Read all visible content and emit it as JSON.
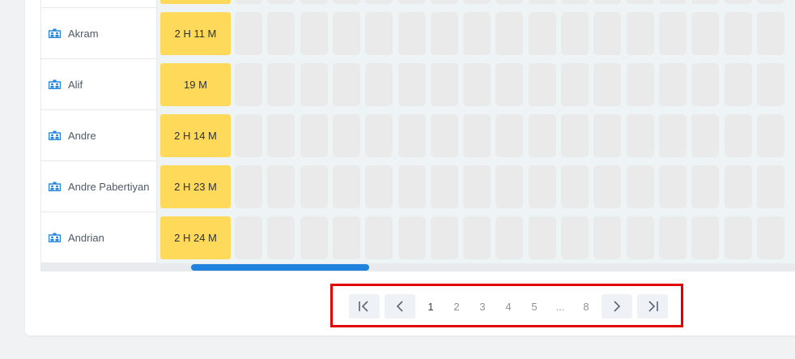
{
  "rows": [
    {
      "name": "Akram",
      "duration": "2 H 11 M"
    },
    {
      "name": "Alif",
      "duration": "19 M"
    },
    {
      "name": "Andre",
      "duration": "2 H 14 M"
    },
    {
      "name": "Andre Pabertiyan",
      "duration": "2 H 23 M"
    },
    {
      "name": "Andrian",
      "duration": "2 H 24 M"
    }
  ],
  "pagination": {
    "first_icon": "first-page-icon",
    "prev_icon": "chevron-left-icon",
    "next_icon": "chevron-right-icon",
    "last_icon": "last-page-icon",
    "pages": [
      "1",
      "2",
      "3",
      "4",
      "5",
      "...",
      "8"
    ],
    "current_page": "1"
  },
  "colors": {
    "duration_bg": "#ffd95a",
    "accent": "#1f82dc",
    "highlight": "#e00000"
  },
  "icons": {
    "row_icon": "team-icon"
  }
}
